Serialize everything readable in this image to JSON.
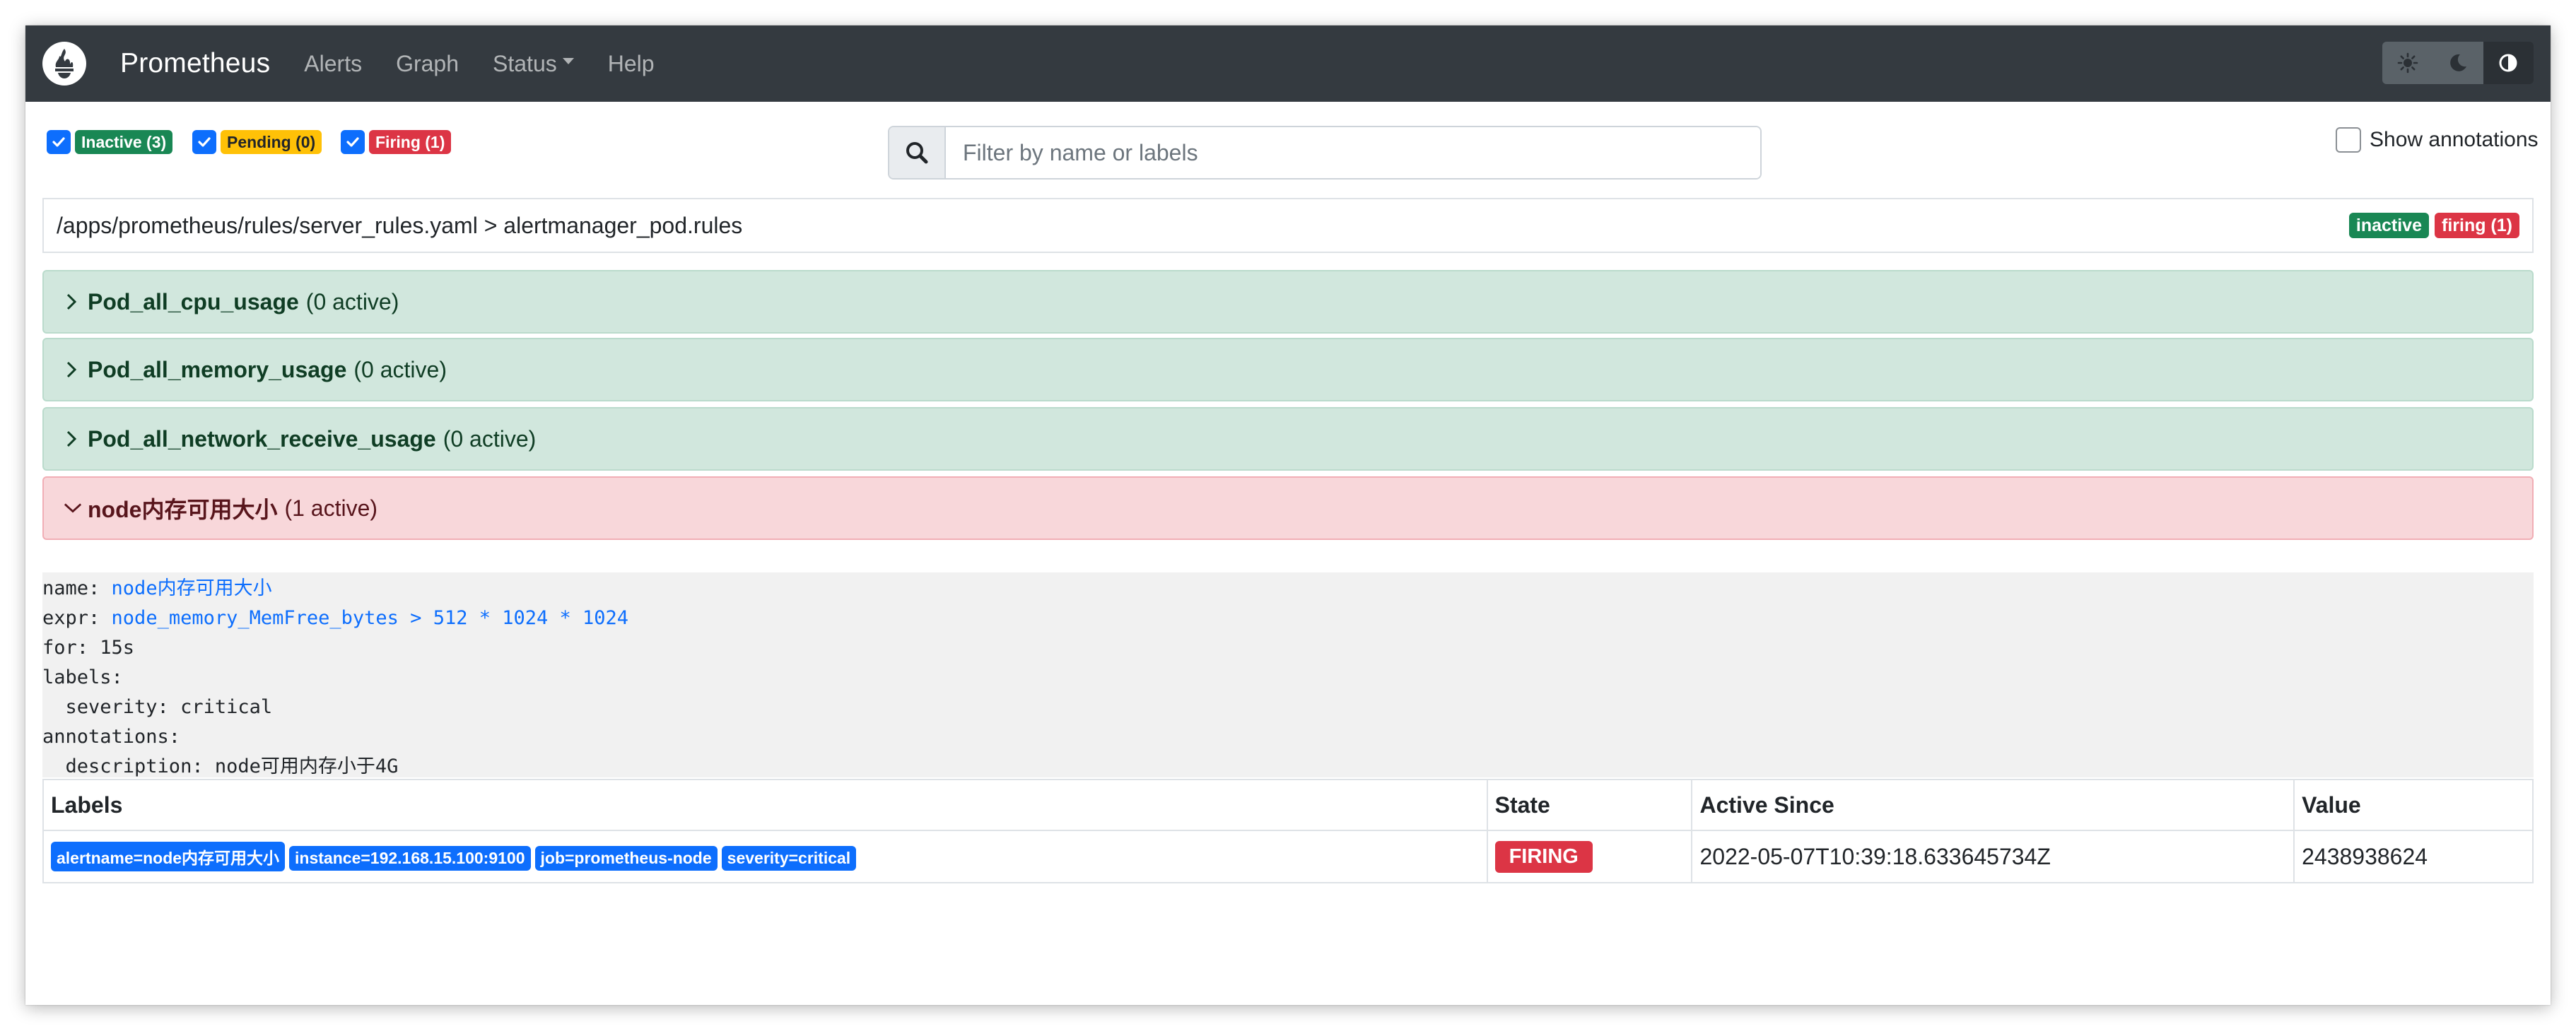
{
  "navbar": {
    "brand": "Prometheus",
    "items": [
      {
        "label": "Alerts"
      },
      {
        "label": "Graph"
      },
      {
        "label": "Status"
      },
      {
        "label": "Help"
      }
    ],
    "theme_buttons": [
      "sun-icon",
      "moon-icon",
      "contrast-icon"
    ]
  },
  "filters": {
    "inactive": "Inactive (3)",
    "pending": "Pending (0)",
    "firing": "Firing (1)",
    "search_placeholder": "Filter by name or labels",
    "show_annotations": "Show annotations"
  },
  "group": {
    "title": "/apps/prometheus/rules/server_rules.yaml > alertmanager_pod.rules",
    "badge_inactive": "inactive",
    "badge_firing": "firing (1)"
  },
  "rules": [
    {
      "name": "Pod_all_cpu_usage",
      "count": "(0 active)",
      "state": "inactive"
    },
    {
      "name": "Pod_all_memory_usage",
      "count": "(0 active)",
      "state": "inactive"
    },
    {
      "name": "Pod_all_network_receive_usage",
      "count": "(0 active)",
      "state": "inactive"
    },
    {
      "name": "node内存可用大小",
      "count": "(1 active)",
      "state": "firing"
    }
  ],
  "rule_detail": {
    "name_key": "name: ",
    "name_val": "node内存可用大小",
    "expr_key": "expr: ",
    "expr_val": "node_memory_MemFree_bytes > 512 * 1024 * 1024",
    "for": "for: 15s",
    "labels": "labels:",
    "severity": "  severity: critical",
    "annotations": "annotations:",
    "description": "  description: node可用内存小于4G"
  },
  "table": {
    "headers": [
      "Labels",
      "State",
      "Active Since",
      "Value"
    ],
    "rows": [
      {
        "labels": [
          "alertname=node内存可用大小",
          "instance=192.168.15.100:9100",
          "job=prometheus-node",
          "severity=critical"
        ],
        "state": "FIRING",
        "active_since": "2022-05-07T10:39:18.633645734Z",
        "value": "2438938624"
      }
    ]
  },
  "colors": {
    "navbar": "#343a40",
    "inactive": "#198754",
    "pending": "#ffc107",
    "firing": "#dc3545",
    "primary": "#0d6efd"
  }
}
